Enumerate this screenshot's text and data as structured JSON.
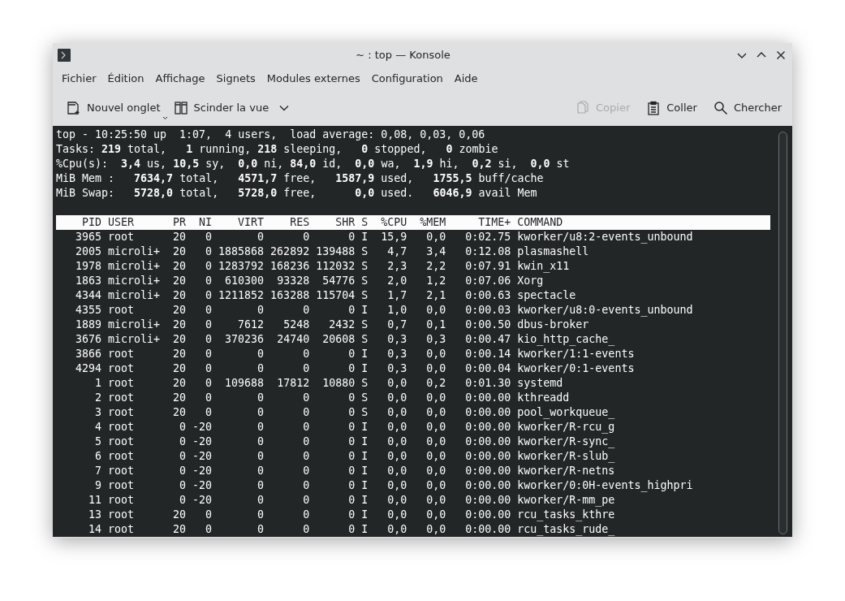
{
  "window": {
    "title": "~ : top — Konsole"
  },
  "menu": [
    "Fichier",
    "Édition",
    "Affichage",
    "Signets",
    "Modules externes",
    "Configuration",
    "Aide"
  ],
  "toolbar": {
    "left": [
      {
        "label": "Nouvel onglet",
        "kind": "new-tab",
        "disabled": false
      },
      {
        "label": "Scinder la vue",
        "kind": "split",
        "disabled": false
      }
    ],
    "right": [
      {
        "label": "Copier",
        "kind": "copy",
        "disabled": true
      },
      {
        "label": "Coller",
        "kind": "paste",
        "disabled": false
      },
      {
        "label": "Chercher",
        "kind": "search",
        "disabled": false
      }
    ]
  },
  "terminal": {
    "summary": [
      "top - 10:25:50 up  1:07,  4 users,  load average: 0,08, 0,03, 0,06",
      "Tasks: **219** total,   **1** running, **218** sleeping,   **0** stopped,   **0** zombie",
      "%Cpu(s):  **3,4** us, **10,5** sy,  **0,0** ni, **84,0** id,  **0,0** wa,  **1,9** hi,  **0,2** si,  **0,0** st",
      "MiB Mem :   **7634,7** total,   **4571,7** free,   **1587,9** used,   **1755,5** buff/cache",
      "MiB Swap:   **5728,0** total,   **5728,0** free,      **0,0** used.   **6046,9** avail Mem"
    ],
    "columns": [
      "PID",
      "USER",
      "PR",
      "NI",
      "VIRT",
      "RES",
      "SHR",
      "S",
      "%CPU",
      "%MEM",
      "TIME+",
      "COMMAND"
    ],
    "rows": [
      [
        "3965",
        "root",
        "20",
        "0",
        "0",
        "0",
        "0",
        "I",
        "15,9",
        "0,0",
        "0:02.75",
        "kworker/u8:2-events_unbound"
      ],
      [
        "2005",
        "microli+",
        "20",
        "0",
        "1885868",
        "262892",
        "139488",
        "S",
        "4,7",
        "3,4",
        "0:12.08",
        "plasmashell"
      ],
      [
        "1978",
        "microli+",
        "20",
        "0",
        "1283792",
        "168236",
        "112032",
        "S",
        "2,3",
        "2,2",
        "0:07.91",
        "kwin_x11"
      ],
      [
        "1863",
        "microli+",
        "20",
        "0",
        "610300",
        "93328",
        "54776",
        "S",
        "2,0",
        "1,2",
        "0:07.06",
        "Xorg"
      ],
      [
        "4344",
        "microli+",
        "20",
        "0",
        "1211852",
        "163288",
        "115704",
        "S",
        "1,7",
        "2,1",
        "0:00.63",
        "spectacle"
      ],
      [
        "4355",
        "root",
        "20",
        "0",
        "0",
        "0",
        "0",
        "I",
        "1,0",
        "0,0",
        "0:00.03",
        "kworker/u8:0-events_unbound"
      ],
      [
        "1889",
        "microli+",
        "20",
        "0",
        "7612",
        "5248",
        "2432",
        "S",
        "0,7",
        "0,1",
        "0:00.50",
        "dbus-broker"
      ],
      [
        "3676",
        "microli+",
        "20",
        "0",
        "370236",
        "24740",
        "20608",
        "S",
        "0,3",
        "0,3",
        "0:00.47",
        "kio_http_cache_"
      ],
      [
        "3866",
        "root",
        "20",
        "0",
        "0",
        "0",
        "0",
        "I",
        "0,3",
        "0,0",
        "0:00.14",
        "kworker/1:1-events"
      ],
      [
        "4294",
        "root",
        "20",
        "0",
        "0",
        "0",
        "0",
        "I",
        "0,3",
        "0,0",
        "0:00.04",
        "kworker/0:1-events"
      ],
      [
        "1",
        "root",
        "20",
        "0",
        "109688",
        "17812",
        "10880",
        "S",
        "0,0",
        "0,2",
        "0:01.30",
        "systemd"
      ],
      [
        "2",
        "root",
        "20",
        "0",
        "0",
        "0",
        "0",
        "S",
        "0,0",
        "0,0",
        "0:00.00",
        "kthreadd"
      ],
      [
        "3",
        "root",
        "20",
        "0",
        "0",
        "0",
        "0",
        "S",
        "0,0",
        "0,0",
        "0:00.00",
        "pool_workqueue_"
      ],
      [
        "4",
        "root",
        "0",
        "-20",
        "0",
        "0",
        "0",
        "I",
        "0,0",
        "0,0",
        "0:00.00",
        "kworker/R-rcu_g"
      ],
      [
        "5",
        "root",
        "0",
        "-20",
        "0",
        "0",
        "0",
        "I",
        "0,0",
        "0,0",
        "0:00.00",
        "kworker/R-sync_"
      ],
      [
        "6",
        "root",
        "0",
        "-20",
        "0",
        "0",
        "0",
        "I",
        "0,0",
        "0,0",
        "0:00.00",
        "kworker/R-slub_"
      ],
      [
        "7",
        "root",
        "0",
        "-20",
        "0",
        "0",
        "0",
        "I",
        "0,0",
        "0,0",
        "0:00.00",
        "kworker/R-netns"
      ],
      [
        "9",
        "root",
        "0",
        "-20",
        "0",
        "0",
        "0",
        "I",
        "0,0",
        "0,0",
        "0:00.00",
        "kworker/0:0H-events_highpri"
      ],
      [
        "11",
        "root",
        "0",
        "-20",
        "0",
        "0",
        "0",
        "I",
        "0,0",
        "0,0",
        "0:00.00",
        "kworker/R-mm_pe"
      ],
      [
        "13",
        "root",
        "20",
        "0",
        "0",
        "0",
        "0",
        "I",
        "0,0",
        "0,0",
        "0:00.00",
        "rcu_tasks_kthre"
      ],
      [
        "14",
        "root",
        "20",
        "0",
        "0",
        "0",
        "0",
        "I",
        "0,0",
        "0,0",
        "0:00.00",
        "rcu_tasks_rude_"
      ]
    ]
  }
}
